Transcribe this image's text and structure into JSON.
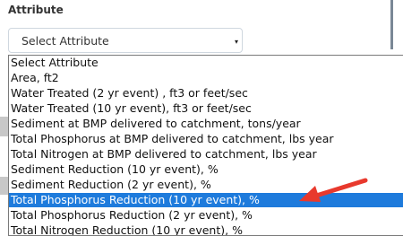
{
  "attribute_label": "Attribute",
  "select": {
    "value": "Select Attribute",
    "caret_icon": "▾"
  },
  "dropdown": {
    "options": [
      "Select Attribute",
      "Area, ft2",
      "Water Treated (2 yr event) , ft3 or feet/sec",
      "Water Treated (10 yr event), ft3 or feet/sec",
      "Sediment at BMP delivered to catchment, tons/year",
      "Total Phosphorus at BMP delivered to catchment, lbs year",
      "Total Nitrogen at BMP delivered to catchment, lbs year",
      "Sediment Reduction (10 yr event), %",
      "Sediment Reduction (2 yr event), %",
      "Total Phosphorus Reduction (10 yr event), %",
      "Total Phosphorus Reduction (2 yr event), %",
      "Total Nitrogen Reduction (10 yr event), %"
    ],
    "selected_index": 9
  },
  "colors": {
    "highlight": "#1e7bdc",
    "arrow": "#e8392d"
  }
}
